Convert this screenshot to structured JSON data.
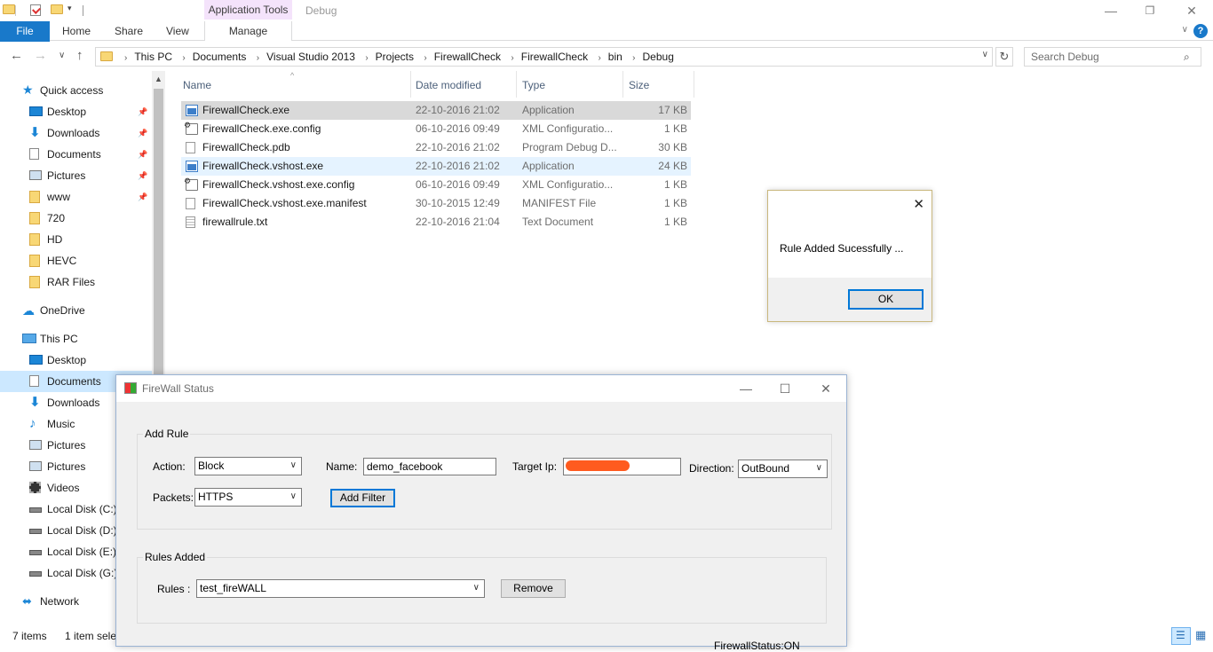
{
  "window": {
    "title": "Debug",
    "context_tab": "Application Tools",
    "controls": {
      "minimize": "—",
      "restore": "❐",
      "close": "✕"
    }
  },
  "ribbon": {
    "file": "File",
    "tabs": [
      "Home",
      "Share",
      "View"
    ],
    "context_tab": "Manage",
    "collapse": "∨",
    "help": "?"
  },
  "nav": {
    "back": "←",
    "forward": "→",
    "recent": "∨",
    "up": "↑",
    "breadcrumb": [
      "This PC",
      "Documents",
      "Visual Studio 2013",
      "Projects",
      "FirewallCheck",
      "FirewallCheck",
      "bin",
      "Debug"
    ],
    "breadcrumb_sep": "›",
    "refresh": "↻",
    "search_placeholder": "Search Debug",
    "search_icon": "search-icon"
  },
  "sidebar": {
    "items": [
      {
        "label": "Quick access",
        "icon": "star-icon",
        "pinned": false
      },
      {
        "label": "Desktop",
        "icon": "desktop-icon",
        "pinned": true
      },
      {
        "label": "Downloads",
        "icon": "download-icon",
        "pinned": true
      },
      {
        "label": "Documents",
        "icon": "documents-icon",
        "pinned": true
      },
      {
        "label": "Pictures",
        "icon": "pictures-icon",
        "pinned": true
      },
      {
        "label": "www",
        "icon": "folder-icon",
        "pinned": true
      },
      {
        "label": "720",
        "icon": "folder-icon",
        "pinned": false
      },
      {
        "label": "HD",
        "icon": "folder-icon",
        "pinned": false
      },
      {
        "label": "HEVC",
        "icon": "folder-icon",
        "pinned": false
      },
      {
        "label": "RAR Files",
        "icon": "folder-icon",
        "pinned": false
      },
      {
        "label": "OneDrive",
        "icon": "cloud-icon",
        "pinned": false
      },
      {
        "label": "This PC",
        "icon": "computer-icon",
        "pinned": false
      },
      {
        "label": "Desktop",
        "icon": "desktop-icon",
        "pinned": false
      },
      {
        "label": "Documents",
        "icon": "documents-icon",
        "pinned": false,
        "selected": true
      },
      {
        "label": "Downloads",
        "icon": "download-icon",
        "pinned": false
      },
      {
        "label": "Music",
        "icon": "music-icon",
        "pinned": false
      },
      {
        "label": "Pictures",
        "icon": "pictures-icon",
        "pinned": false
      },
      {
        "label": "Pictures",
        "icon": "pictures-icon",
        "pinned": false
      },
      {
        "label": "Videos",
        "icon": "videos-icon",
        "pinned": false
      },
      {
        "label": "Local Disk (C:)",
        "icon": "disk-icon",
        "pinned": false
      },
      {
        "label": "Local Disk (D:)",
        "icon": "disk-icon",
        "pinned": false
      },
      {
        "label": "Local Disk (E:)",
        "icon": "disk-icon",
        "pinned": false
      },
      {
        "label": "Local Disk (G:)",
        "icon": "disk-icon",
        "pinned": false
      },
      {
        "label": "Network",
        "icon": "network-icon",
        "pinned": false
      }
    ]
  },
  "files": {
    "columns": [
      "Name",
      "Date modified",
      "Type",
      "Size"
    ],
    "sort_indicator": "^",
    "rows": [
      {
        "name": "FirewallCheck.exe",
        "date": "22-10-2016 21:02",
        "type": "Application",
        "size": "17 KB",
        "icon": "application-icon",
        "state": "selected"
      },
      {
        "name": "FirewallCheck.exe.config",
        "date": "06-10-2016 09:49",
        "type": "XML Configuratio...",
        "size": "1 KB",
        "icon": "config-file-icon",
        "state": ""
      },
      {
        "name": "FirewallCheck.pdb",
        "date": "22-10-2016 21:02",
        "type": "Program Debug D...",
        "size": "30 KB",
        "icon": "file-icon",
        "state": ""
      },
      {
        "name": "FirewallCheck.vshost.exe",
        "date": "22-10-2016 21:02",
        "type": "Application",
        "size": "24 KB",
        "icon": "application-icon",
        "state": "hover"
      },
      {
        "name": "FirewallCheck.vshost.exe.config",
        "date": "06-10-2016 09:49",
        "type": "XML Configuratio...",
        "size": "1 KB",
        "icon": "config-file-icon",
        "state": ""
      },
      {
        "name": "FirewallCheck.vshost.exe.manifest",
        "date": "30-10-2015 12:49",
        "type": "MANIFEST File",
        "size": "1 KB",
        "icon": "file-icon",
        "state": ""
      },
      {
        "name": "firewallrule.txt",
        "date": "22-10-2016 21:04",
        "type": "Text Document",
        "size": "1 KB",
        "icon": "text-file-icon",
        "state": ""
      }
    ]
  },
  "statusbar": {
    "count": "7 items",
    "selection": "1 item sele"
  },
  "messagebox": {
    "text": "Rule Added Sucessfully ...",
    "ok": "OK",
    "close": "✕"
  },
  "firewall_form": {
    "title": "FireWall Status",
    "controls": {
      "minimize": "—",
      "maximize": "☐",
      "close": "✕"
    },
    "add_rule": {
      "group_title": "Add Rule",
      "action_label": "Action:",
      "action_value": "Block",
      "name_label": "Name:",
      "name_value": "demo_facebook",
      "target_label": "Target Ip:",
      "target_value": "",
      "direction_label": "Direction:",
      "direction_value": "OutBound",
      "packets_label": "Packets:",
      "packets_value": "HTTPS",
      "add_filter": "Add Filter"
    },
    "rules_added": {
      "group_title": "Rules Added",
      "rules_label": "Rules :",
      "rules_value": "test_fireWALL",
      "remove": "Remove"
    },
    "status_text": "FirewallStatus:ON"
  },
  "colors": {
    "accent": "#0078d7",
    "file_tab": "#1979ca",
    "context_tab_bg": "#f4e3fb",
    "selection": "#cce8ff",
    "redaction": "#ff5b1f"
  }
}
